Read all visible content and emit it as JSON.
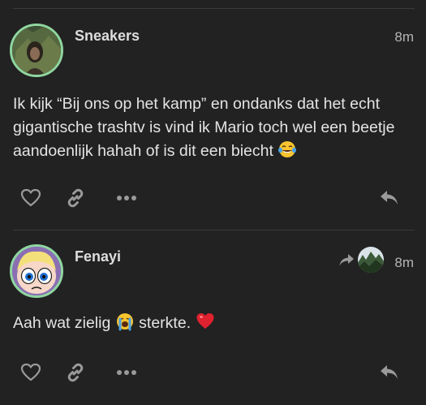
{
  "posts": [
    {
      "username": "Sneakers",
      "time": "8m",
      "body": "Ik kijk “Bij ons op het kamp” en ondanks dat het echt gigantische trashtv is vind ik Mario toch wel een beetje aandoenlijk hahah of is dit een biecht",
      "emoji": "face-with-tears-of-joy-icon",
      "avatar_border": "#8fd6a0"
    },
    {
      "username": "Fenayi",
      "time": "8m",
      "body_part1": "Aah wat zielig",
      "body_part2": "sterkte.",
      "avatar_border": "#8fd6a0"
    }
  ],
  "colors": {
    "background": "#222222",
    "text": "#e4e4e4",
    "icon": "#9a9a9a",
    "divider": "#3a3a3a"
  }
}
